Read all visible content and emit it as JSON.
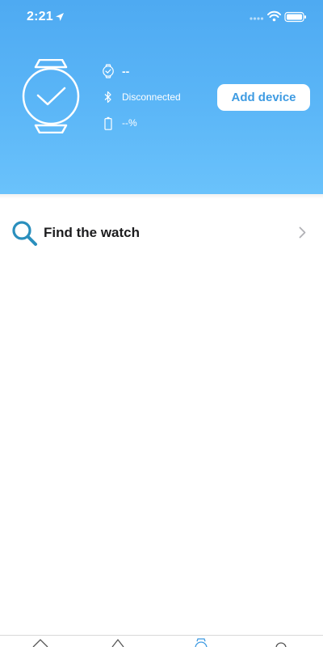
{
  "status_bar": {
    "time": "2:21",
    "icons": [
      "location-arrow-icon",
      "cellular-signal-icon",
      "wifi-icon",
      "battery-icon"
    ]
  },
  "device_panel": {
    "watch_name": "--",
    "connection_status": "Disconnected",
    "battery_level": "--%",
    "add_device_label": "Add device"
  },
  "menu": {
    "items": [
      {
        "label": "Find the watch",
        "icon": "magnifier-icon"
      }
    ]
  },
  "tab_bar": {
    "tabs": [
      {
        "icon": "home-icon",
        "active": false
      },
      {
        "icon": "diamond-icon",
        "active": false
      },
      {
        "icon": "watch-icon",
        "active": true
      },
      {
        "icon": "profile-icon",
        "active": false
      }
    ]
  },
  "colors": {
    "header_top": "#4eaaf2",
    "header_bottom": "#6ac2fb",
    "accent": "#3e9be2",
    "find_icon": "#2a8fbd",
    "text_dark": "#1c1c1e"
  }
}
